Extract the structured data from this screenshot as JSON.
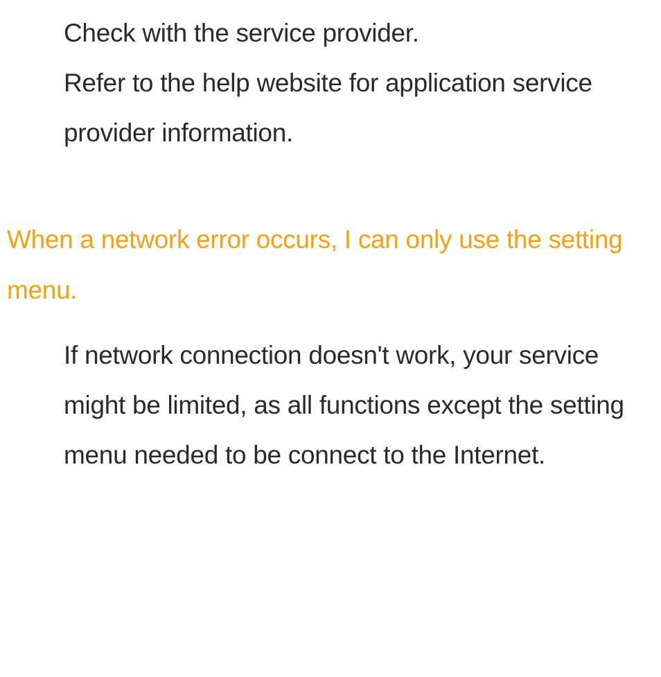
{
  "intro": {
    "line1": "Check with the service provider.",
    "line2": "Refer to the help website for application service provider information."
  },
  "section": {
    "heading": "When a network error occurs, I can only use the setting menu.",
    "body": "If network connection doesn't work, your service might be limited, as all functions except the setting menu needed to be connect to the Internet."
  }
}
